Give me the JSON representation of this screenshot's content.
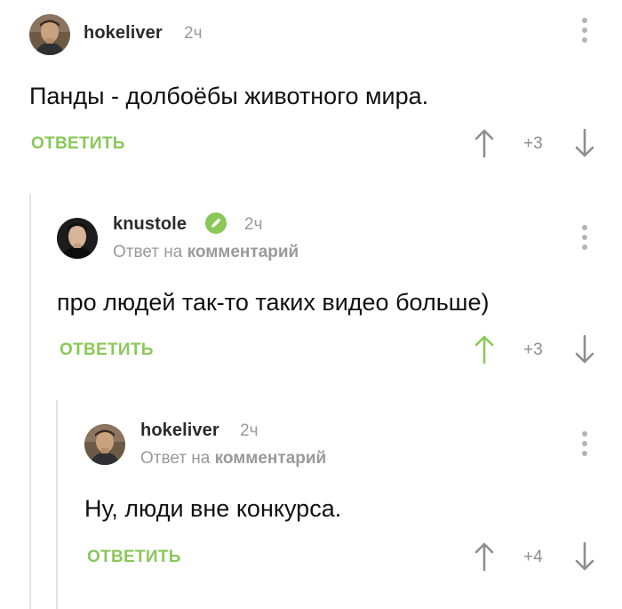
{
  "comments": [
    {
      "username": "hokeliver",
      "time": "2ч",
      "text": "Панды - долбоёбы животного мира.",
      "reply_label": "ОТВЕТИТЬ",
      "score": "+3"
    },
    {
      "username": "knustole",
      "time": "2ч",
      "reply_note_prefix": "Ответ на",
      "reply_note_link": "комментарий",
      "text": "про людей так-то таких видео больше)",
      "reply_label": "ОТВЕТИТЬ",
      "score": "+3"
    },
    {
      "username": "hokeliver",
      "time": "2ч",
      "reply_note_prefix": "Ответ на",
      "reply_note_link": "комментарий",
      "text": "Ну, люди вне конкурса.",
      "reply_label": "ОТВЕТИТЬ",
      "score": "+4"
    }
  ],
  "colors": {
    "accent_green": "#8ac858",
    "muted_gray": "#9a9a9a",
    "thread_line": "#e4e4e4"
  },
  "icons": {
    "menu": "vertical-dots-icon",
    "upvote": "arrow-up-icon",
    "downvote": "arrow-down-icon",
    "verified": "pencil-badge-icon"
  }
}
